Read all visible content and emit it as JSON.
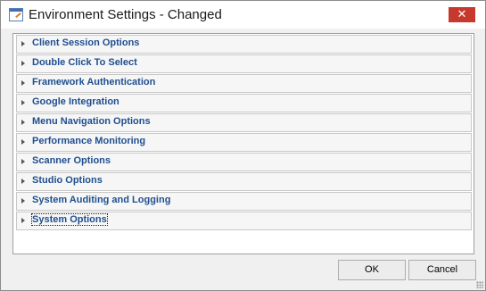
{
  "window": {
    "title": "Environment Settings - Changed",
    "close_glyph": "✕"
  },
  "groups": [
    {
      "label": "Client Session Options"
    },
    {
      "label": "Double Click To Select"
    },
    {
      "label": "Framework Authentication"
    },
    {
      "label": "Google Integration"
    },
    {
      "label": "Menu Navigation Options"
    },
    {
      "label": "Performance Monitoring"
    },
    {
      "label": "Scanner Options"
    },
    {
      "label": "Studio Options"
    },
    {
      "label": "System Auditing and Logging"
    },
    {
      "label": "System Options",
      "focused": true
    }
  ],
  "buttons": {
    "ok_label": "OK",
    "cancel_label": "Cancel"
  },
  "colors": {
    "group_label": "#1f4f8f",
    "close_button": "#c7392c"
  },
  "icons": {
    "app": "settings-window-icon",
    "expander": "triangle-right-icon",
    "close": "close-icon"
  }
}
